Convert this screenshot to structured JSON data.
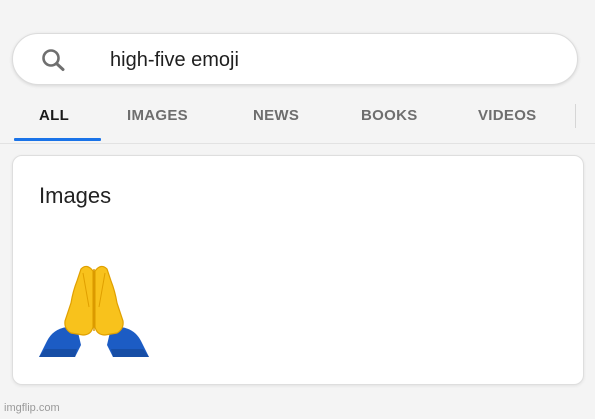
{
  "search": {
    "query": "high-five emoji",
    "icon": "search-icon"
  },
  "tabs": [
    {
      "label": "ALL",
      "active": true
    },
    {
      "label": "IMAGES",
      "active": false
    },
    {
      "label": "NEWS",
      "active": false
    },
    {
      "label": "BOOKS",
      "active": false
    },
    {
      "label": "VIDEOS",
      "active": false
    }
  ],
  "images_section": {
    "heading": "Images",
    "result_icon": "praying-hands-icon"
  },
  "watermark": "imgflip.com",
  "colors": {
    "active_tab_underline": "#1a73e8",
    "sleeve": "#1c5cc4",
    "hand": "#f8c21c"
  }
}
